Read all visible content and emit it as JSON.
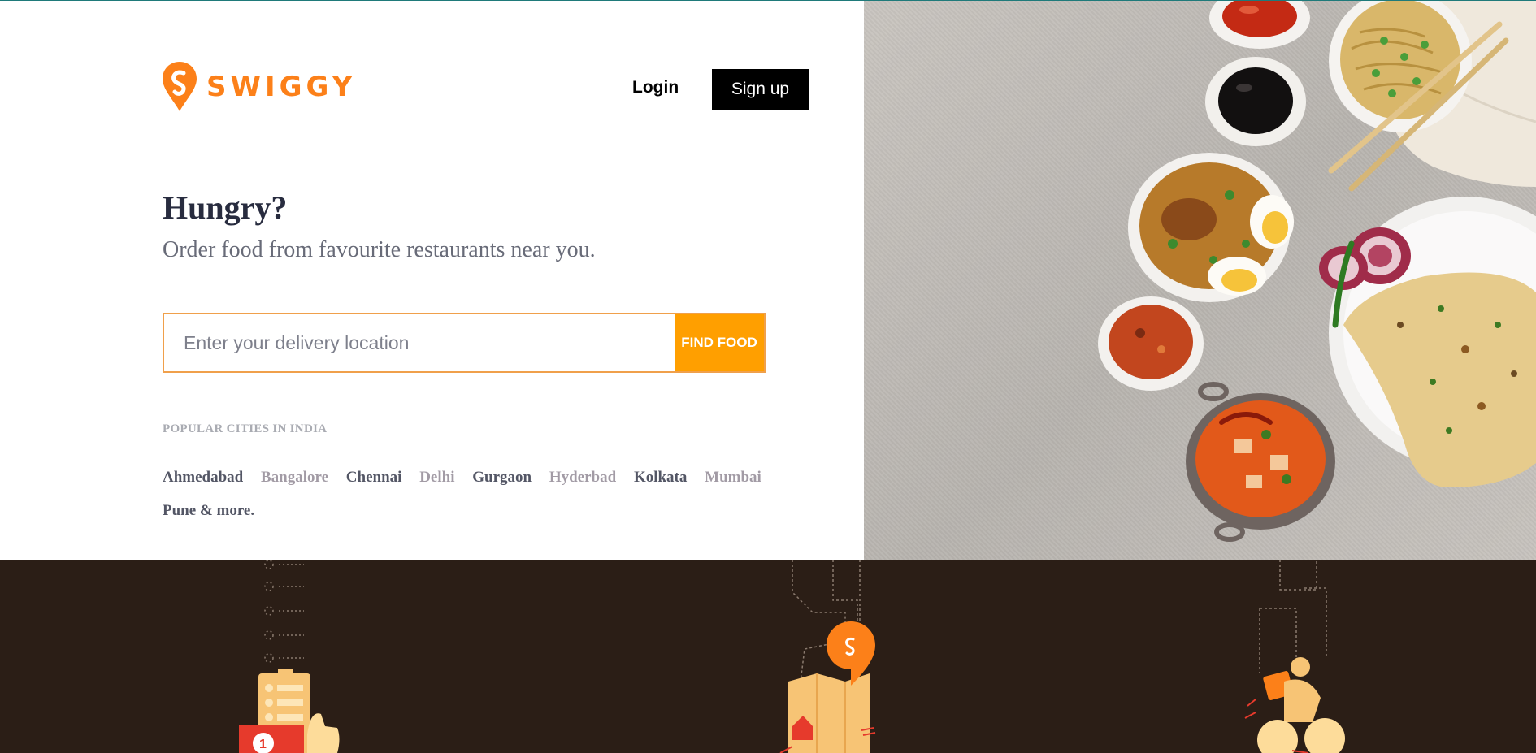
{
  "brand": {
    "name": "SWIGGY",
    "accent": "#fc8019",
    "logo_icon": "swiggy-pin-logo-icon"
  },
  "header": {
    "login_label": "Login",
    "signup_label": "Sign up"
  },
  "hero": {
    "headline": "Hungry?",
    "subline": "Order food from favourite restaurants near you.",
    "search": {
      "placeholder": "Enter your delivery location",
      "value": "",
      "button_label": "FIND FOOD",
      "button_color": "#ff9f00"
    },
    "popular": {
      "title": "POPULAR CITIES IN INDIA",
      "cities": [
        {
          "name": "Ahmedabad",
          "tone": "dark"
        },
        {
          "name": "Bangalore",
          "tone": "light"
        },
        {
          "name": "Chennai",
          "tone": "dark"
        },
        {
          "name": "Delhi",
          "tone": "light"
        },
        {
          "name": "Gurgaon",
          "tone": "dark"
        },
        {
          "name": "Hyderbad",
          "tone": "light"
        },
        {
          "name": "Kolkata",
          "tone": "dark"
        },
        {
          "name": "Mumbai",
          "tone": "light"
        },
        {
          "name": "Pune & more.",
          "tone": "dark"
        }
      ]
    }
  },
  "photo": {
    "subject": "food-photo",
    "items": [
      "ketchup-bowl-icon",
      "soy-sauce-bowl-icon",
      "noodles-bowl-icon",
      "biryani-bowl-icon",
      "onion-chili-plate-icon",
      "naan-plate-icon",
      "chutney-bowl-icon",
      "paneer-curry-kadai-icon"
    ]
  },
  "features_band": {
    "background": "#2b1e16",
    "illustrations": [
      "order-list-thumbs-up-icon",
      "map-location-pin-icon",
      "delivery-rider-icon"
    ]
  }
}
